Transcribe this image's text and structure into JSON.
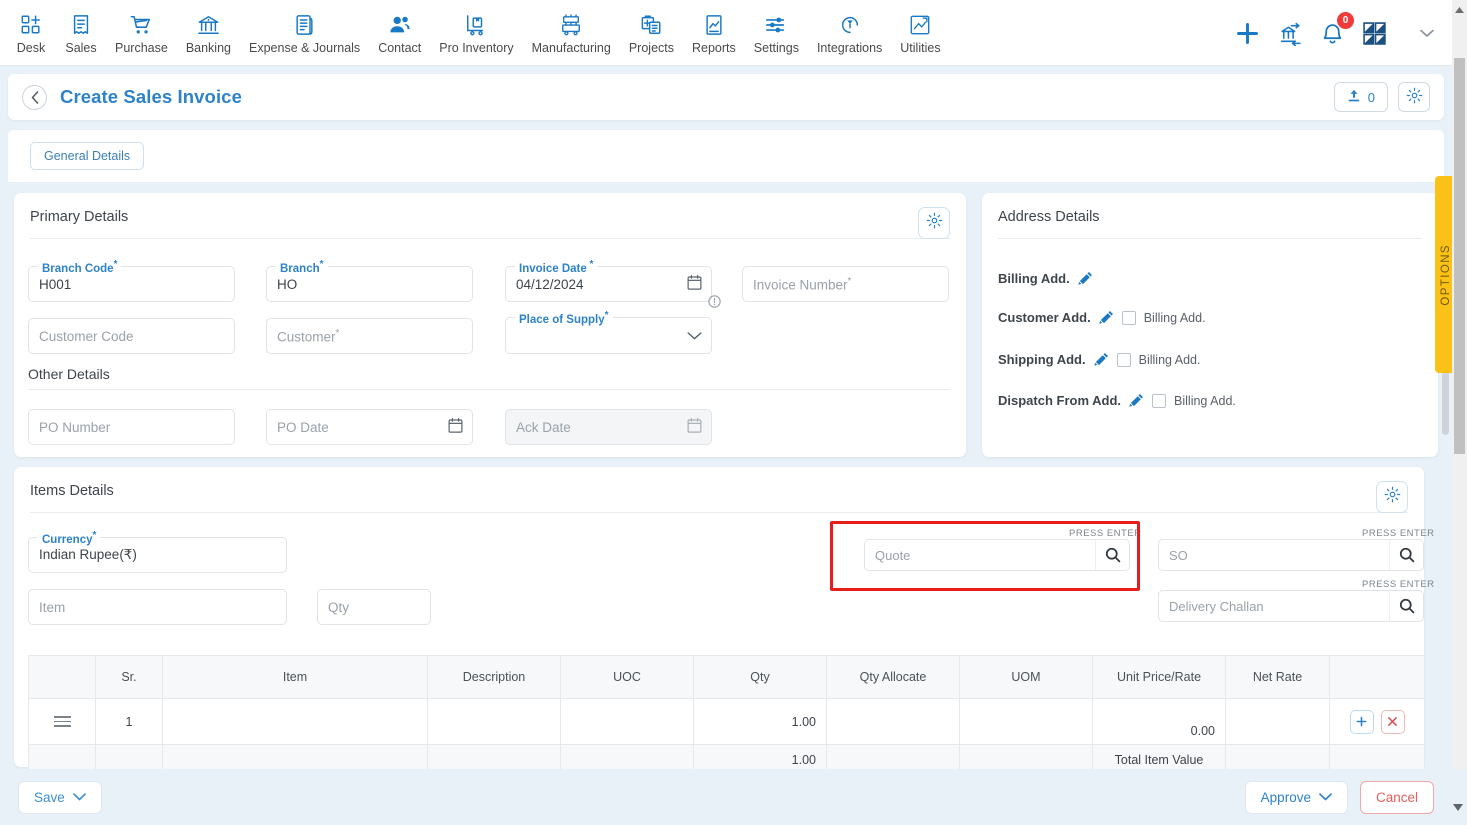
{
  "topnav": {
    "items": [
      {
        "label": "Desk",
        "icon": "dashboard-icon"
      },
      {
        "label": "Sales",
        "icon": "receipt-icon"
      },
      {
        "label": "Purchase",
        "icon": "cart-icon"
      },
      {
        "label": "Banking",
        "icon": "bank-icon"
      },
      {
        "label": "Expense & Journals",
        "icon": "journal-icon"
      },
      {
        "label": "Contact",
        "icon": "contacts-icon"
      },
      {
        "label": "Pro Inventory",
        "icon": "inventory-trolley-icon"
      },
      {
        "label": "Manufacturing",
        "icon": "factory-icon"
      },
      {
        "label": "Projects",
        "icon": "projects-icon"
      },
      {
        "label": "Reports",
        "icon": "reports-icon"
      },
      {
        "label": "Settings",
        "icon": "sliders-icon"
      },
      {
        "label": "Integrations",
        "icon": "plug-icon"
      },
      {
        "label": "Utilities",
        "icon": "utilities-icon"
      }
    ],
    "actions": {
      "add": "plus-icon",
      "company": "bank-transfer-icon",
      "notifications": "bell-icon",
      "notification_count": "0",
      "apps": "grid-icon",
      "profile_caret": "chevron-down-icon"
    }
  },
  "header": {
    "back": "chevron-left-icon",
    "title": "Create Sales Invoice",
    "attachment_count": "0",
    "attachment_icon": "upload-icon",
    "settings_icon": "gear-icon"
  },
  "tabs": [
    {
      "label": "General Details",
      "active": true
    }
  ],
  "options_tab": {
    "label": "OPTIONS"
  },
  "primary_details": {
    "title": "Primary Details",
    "gear_icon": "gear-icon",
    "fields": {
      "branch_code": {
        "label": "Branch Code",
        "required": true,
        "value": "H001"
      },
      "branch": {
        "label": "Branch",
        "required": true,
        "value": "HO"
      },
      "invoice_date": {
        "label": "Invoice Date",
        "required": true,
        "value": "04/12/2024",
        "icon": "calendar-icon"
      },
      "invoice_number": {
        "placeholder": "Invoice Number",
        "required": true,
        "value": ""
      },
      "customer_code": {
        "placeholder": "Customer Code",
        "required": false,
        "value": ""
      },
      "customer": {
        "placeholder": "Customer",
        "required": true,
        "value": ""
      },
      "place_of_supply": {
        "label": "Place of Supply",
        "required": true,
        "value": "",
        "icon": "chevron-down-icon",
        "info_icon": "info-icon"
      }
    },
    "other_details": {
      "title": "Other Details",
      "po_number": {
        "placeholder": "PO Number",
        "value": ""
      },
      "po_date": {
        "placeholder": "PO Date",
        "value": "",
        "icon": "calendar-icon"
      },
      "ack_date": {
        "placeholder": "Ack Date",
        "value": "",
        "icon": "calendar-icon",
        "disabled": true
      }
    }
  },
  "address_details": {
    "title": "Address Details",
    "rows": [
      {
        "label": "Billing Add.",
        "edit_icon": "pencil-icon",
        "has_checkbox": false,
        "checkbox_label": "",
        "checked": false
      },
      {
        "label": "Customer Add.",
        "edit_icon": "pencil-icon",
        "has_checkbox": true,
        "checkbox_label": "Billing Add.",
        "checked": false
      },
      {
        "label": "Shipping Add.",
        "edit_icon": "pencil-icon",
        "has_checkbox": true,
        "checkbox_label": "Billing Add.",
        "checked": false
      },
      {
        "label": "Dispatch From Add.",
        "edit_icon": "pencil-icon",
        "has_checkbox": true,
        "checkbox_label": "Billing Add.",
        "checked": false
      }
    ]
  },
  "items_details": {
    "title": "Items Details",
    "gear_icon": "gear-icon",
    "currency": {
      "label": "Currency",
      "required": true,
      "value": "Indian Rupee(₹)"
    },
    "item": {
      "placeholder": "Item",
      "value": ""
    },
    "qty": {
      "placeholder": "Qty",
      "value": ""
    },
    "searches": [
      {
        "name": "quote",
        "hint": "PRESS ENTER",
        "placeholder": "Quote",
        "value": "",
        "icon": "search-icon",
        "highlighted": true
      },
      {
        "name": "so",
        "hint": "PRESS ENTER",
        "placeholder": "SO",
        "value": "",
        "icon": "search-icon",
        "highlighted": false
      },
      {
        "name": "delivery-challan",
        "hint": "PRESS ENTER",
        "placeholder": "Delivery Challan",
        "value": "",
        "icon": "search-icon",
        "highlighted": false
      }
    ],
    "table": {
      "columns": [
        "",
        "Sr.",
        "Item",
        "Description",
        "UOC",
        "Qty",
        "Qty Allocate",
        "UOM",
        "Unit Price/Rate",
        "Net Rate",
        ""
      ],
      "rows": [
        {
          "drag_icon": "drag-handle-icon",
          "sr": "1",
          "item": "",
          "description": "",
          "uoc": "",
          "qty": "1.00",
          "qty_allocate": "",
          "uom": "",
          "unit_price": "0.00",
          "net_rate": "",
          "add_icon": "plus-icon",
          "delete_icon": "close-icon"
        }
      ],
      "totals": {
        "qty": "1.00",
        "label": "Total Item Value"
      }
    }
  },
  "footer": {
    "save": {
      "label": "Save",
      "caret": "chevron-down-icon"
    },
    "approve": {
      "label": "Approve",
      "caret": "chevron-down-icon"
    },
    "cancel": {
      "label": "Cancel"
    }
  },
  "colors": {
    "accent": "#2d82c8",
    "page_bg": "#e9f1f8",
    "danger": "#e75d5d",
    "highlight": "#e51d1d",
    "options_tab": "#fbc116",
    "badge": "#ef3b3b"
  }
}
